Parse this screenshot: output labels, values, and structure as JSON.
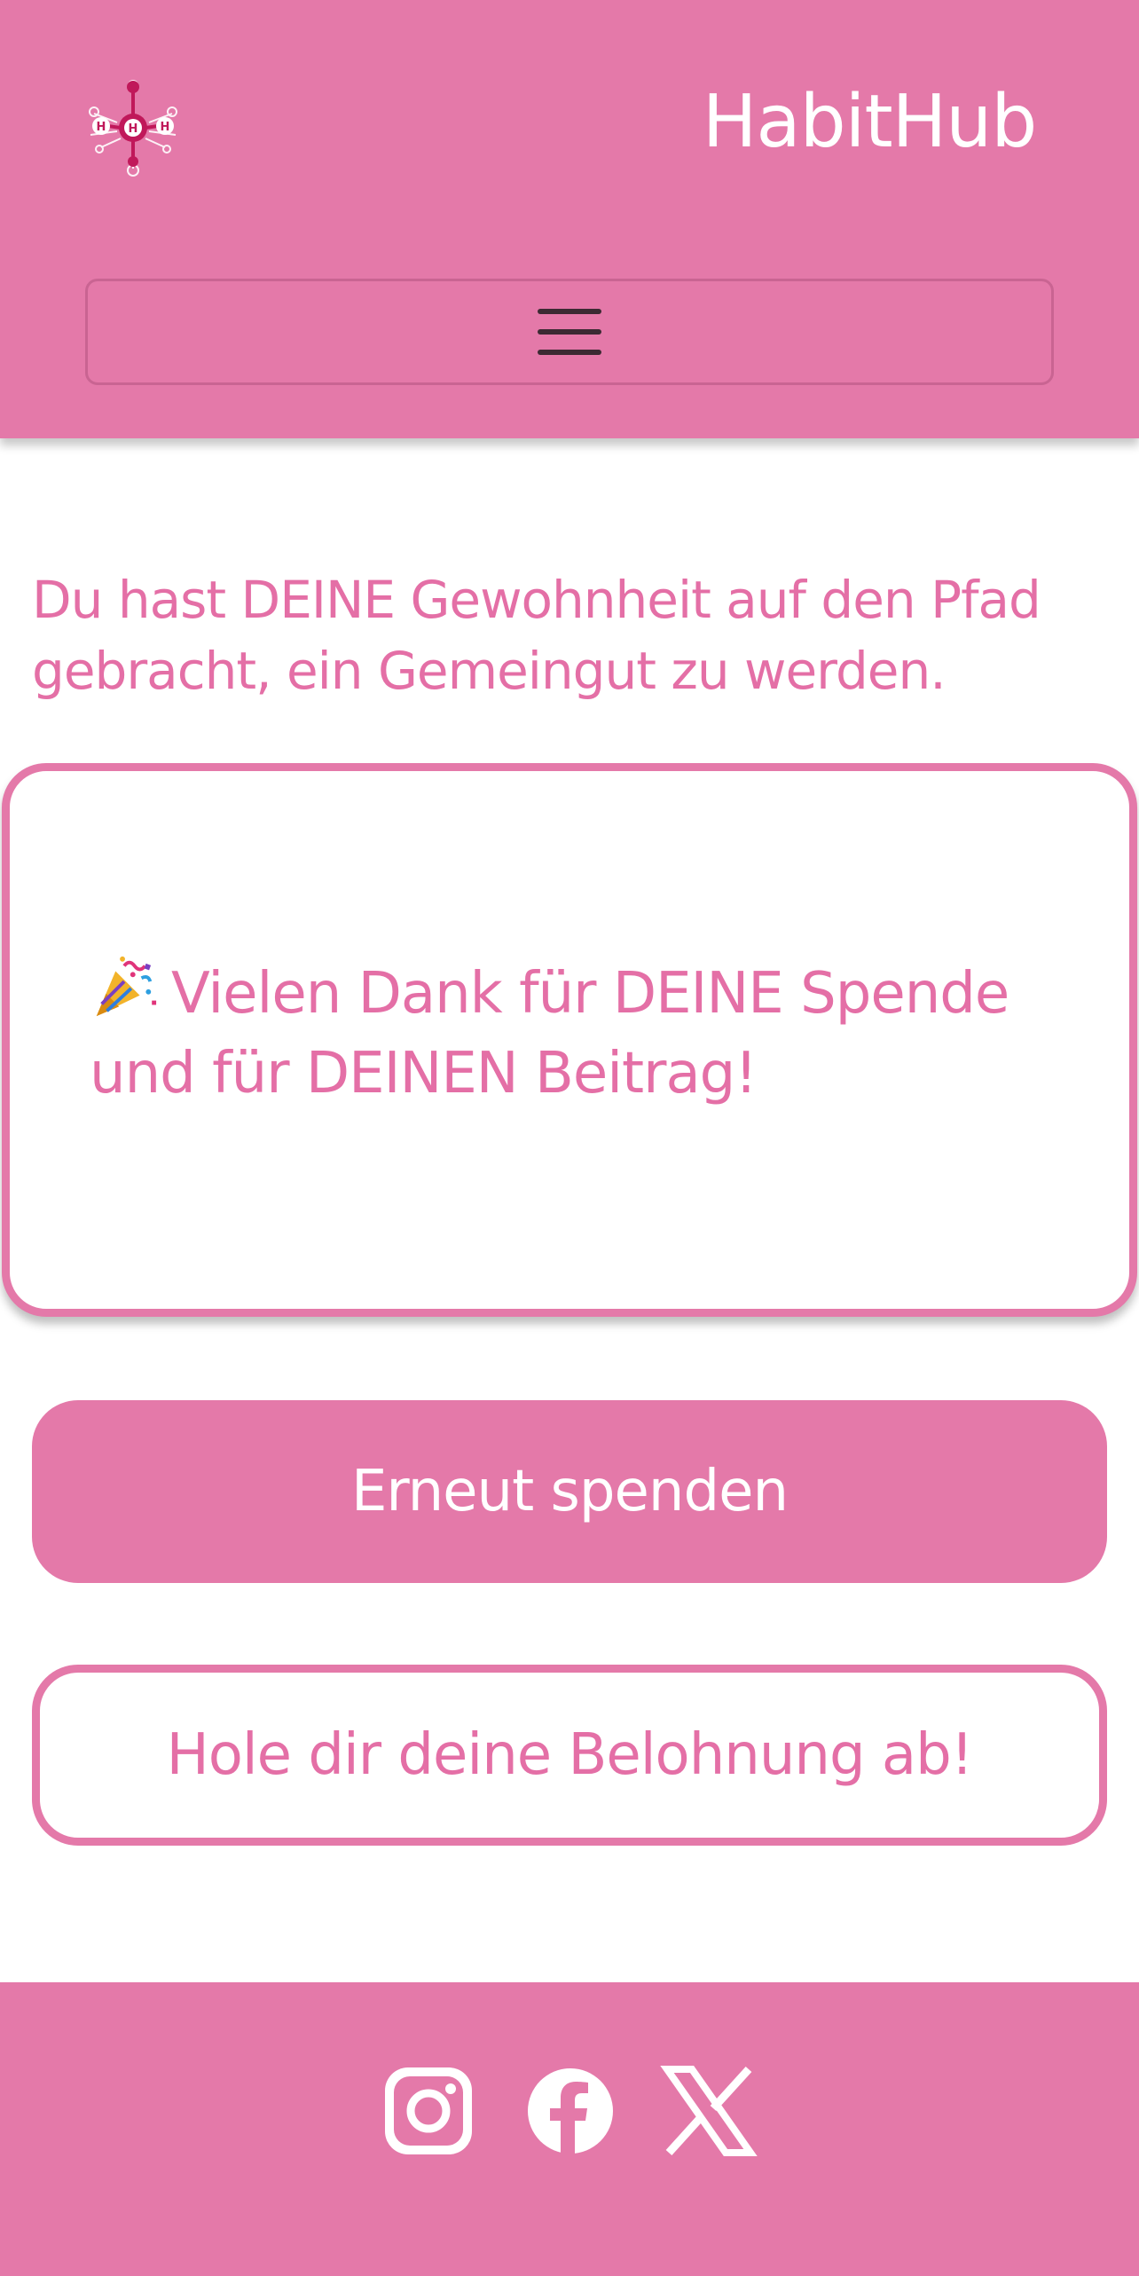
{
  "header": {
    "brand": "HabitHub",
    "logo_icon": "habithub-molecule-logo",
    "menu_icon": "hamburger-menu-icon"
  },
  "main": {
    "intro_text": "Du hast DEINE Gewohnheit auf den Pfad gebracht, ein Gemeingut zu werden.",
    "thanks_icon": "party-popper-icon",
    "thanks_text": "Vielen Dank für DEINE Spende und für DEINEN Beitrag!",
    "donate_again_label": "Erneut spenden",
    "reward_label": "Hole dir deine Belohnung ab!"
  },
  "footer": {
    "social": [
      "instagram-icon",
      "facebook-icon",
      "x-icon"
    ]
  },
  "colors": {
    "brand_pink": "#e479a9",
    "text_pink": "#e46fa6",
    "white": "#ffffff"
  }
}
